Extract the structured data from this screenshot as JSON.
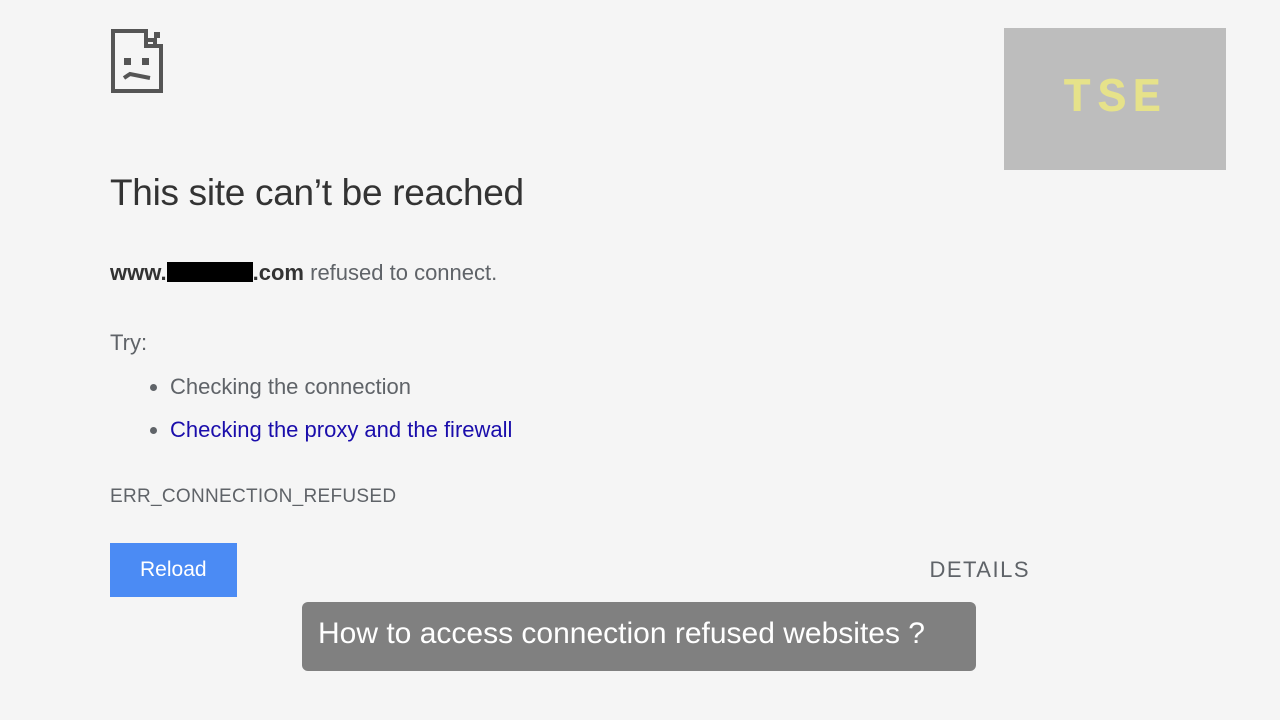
{
  "error": {
    "heading": "This site can’t be reached",
    "domain_prefix": "www.",
    "domain_suffix": ".com",
    "refused_text": " refused to connect.",
    "try_label": "Try:",
    "suggestions": {
      "check_connection": "Checking the connection",
      "check_proxy": "Checking the proxy and the firewall"
    },
    "code": "ERR_CONNECTION_REFUSED"
  },
  "buttons": {
    "reload": "Reload",
    "details": "DETAILS"
  },
  "badge": {
    "label": "TSE"
  },
  "caption": {
    "text": "How to access connection refused websites ?"
  }
}
